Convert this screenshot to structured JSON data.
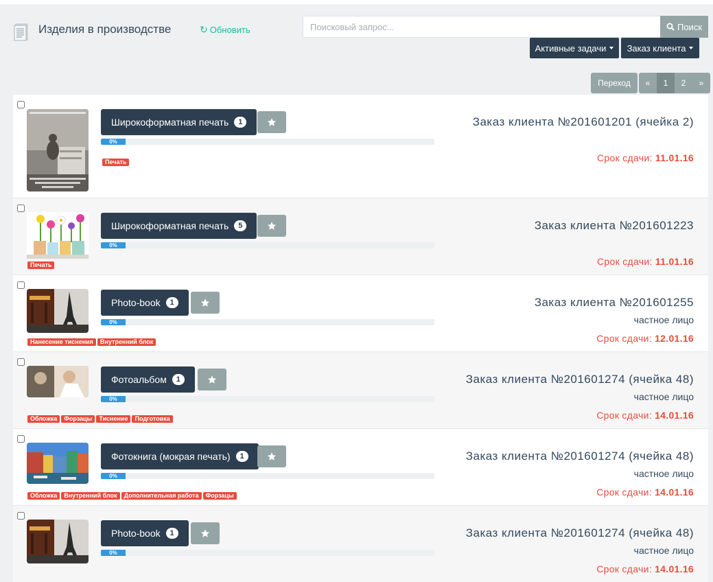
{
  "header": {
    "title": "Изделия в производстве",
    "refresh_label": "Обновить",
    "search_placeholder": "Поисковый запрос...",
    "search_button": "Поиск",
    "active_tasks_label": "Активные задачи",
    "client_order_label": "Заказ клиента"
  },
  "pagination": {
    "goto_label": "Переход",
    "prev": "«",
    "pages": [
      "1",
      "2"
    ],
    "current": "1",
    "next": "»"
  },
  "colors": {
    "primary": "#2c3e50",
    "muted": "#95a5a6",
    "danger": "#e74c3c",
    "info": "#3498db",
    "success": "#18bc9c"
  },
  "items": [
    {
      "product": "Широкоформатная печать",
      "count": "1",
      "progress": "0%",
      "tags": [
        "Печать"
      ],
      "order": "Заказ клиента №201601201 (ячейка 2)",
      "client": "",
      "due_label": "Срок сдачи:",
      "due_date": "11.01.16",
      "thumb": "cat-photo"
    },
    {
      "product": "Широкоформатная печать",
      "count": "5",
      "progress": "0%",
      "tags": [
        "Печать"
      ],
      "order": "Заказ клиента №201601223",
      "client": "",
      "due_label": "Срок сдачи:",
      "due_date": "11.01.16",
      "thumb": "flowers-photo"
    },
    {
      "product": "Photo-book",
      "count": "1",
      "progress": "0%",
      "tags": [
        "Нанесение тиснения",
        "Внутренний блок"
      ],
      "order": "Заказ клиента №201601255",
      "client": "частное лицо",
      "due_label": "Срок сдачи:",
      "due_date": "12.01.16",
      "thumb": "eiffel-photo"
    },
    {
      "product": "Фотоальбом",
      "count": "1",
      "progress": "0%",
      "tags": [
        "Обложка",
        "Форзацы",
        "Тиснение",
        "Подготовка"
      ],
      "order": "Заказ клиента №201601274 (ячейка 48)",
      "client": "частное лицо",
      "due_label": "Срок сдачи:",
      "due_date": "14.01.16",
      "thumb": "album-photo"
    },
    {
      "product": "Фотокнига (мокрая печать)",
      "count": "1",
      "progress": "0%",
      "tags": [
        "Обложка",
        "Внутренний блок",
        "Дополнительная работа",
        "Форзацы"
      ],
      "order": "Заказ клиента №201601274 (ячейка 48)",
      "client": "частное лицо",
      "due_label": "Срок сдачи:",
      "due_date": "14.01.16",
      "thumb": "canal-photo"
    },
    {
      "product": "Photo-book",
      "count": "1",
      "progress": "0%",
      "tags": [],
      "order": "Заказ клиента №201601274 (ячейка 48)",
      "client": "частное лицо",
      "due_label": "Срок сдачи:",
      "due_date": "14.01.16",
      "thumb": "eiffel-photo"
    }
  ]
}
